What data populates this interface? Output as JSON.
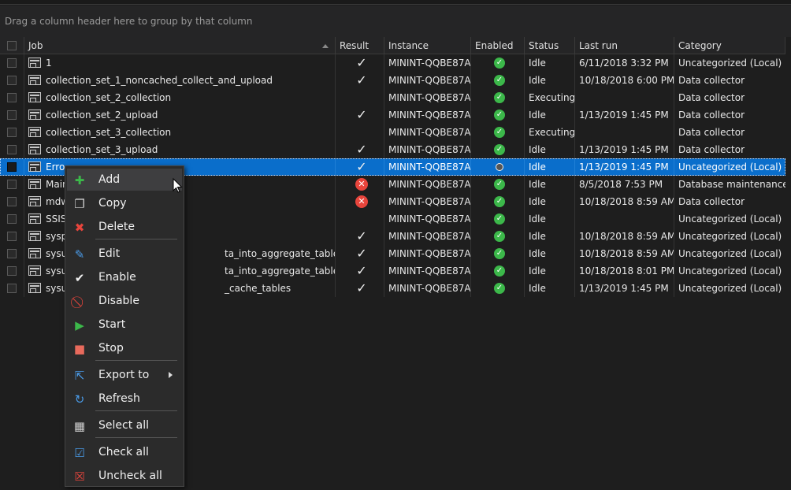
{
  "group_panel": {
    "hint": "Drag a column header here to group by that column"
  },
  "columns": [
    "Job",
    "Result",
    "Instance",
    "Enabled",
    "Status",
    "Last run",
    "Category"
  ],
  "rows": [
    {
      "job": "1",
      "result": "ok",
      "instance": "MININT-QQBE87A",
      "enabled": "on",
      "status": "Idle",
      "last_run": "6/11/2018 3:32 PM",
      "category": "Uncategorized (Local)"
    },
    {
      "job": "collection_set_1_noncached_collect_and_upload",
      "result": "ok",
      "instance": "MININT-QQBE87A",
      "enabled": "on",
      "status": "Idle",
      "last_run": "10/18/2018 6:00 PM",
      "category": "Data collector"
    },
    {
      "job": "collection_set_2_collection",
      "result": "",
      "instance": "MININT-QQBE87A",
      "enabled": "on",
      "status": "Executing",
      "last_run": "",
      "category": "Data collector"
    },
    {
      "job": "collection_set_2_upload",
      "result": "ok",
      "instance": "MININT-QQBE87A",
      "enabled": "on",
      "status": "Idle",
      "last_run": "1/13/2019 1:45 PM",
      "category": "Data collector"
    },
    {
      "job": "collection_set_3_collection",
      "result": "",
      "instance": "MININT-QQBE87A",
      "enabled": "on",
      "status": "Executing",
      "last_run": "",
      "category": "Data collector"
    },
    {
      "job": "collection_set_3_upload",
      "result": "ok",
      "instance": "MININT-QQBE87A",
      "enabled": "on",
      "status": "Idle",
      "last_run": "1/13/2019 1:45 PM",
      "category": "Data collector"
    },
    {
      "job": "Erro",
      "result": "ok",
      "instance": "MININT-QQBE87A",
      "enabled": "off",
      "status": "Idle",
      "last_run": "1/13/2019 1:45 PM",
      "category": "Uncategorized (Local)",
      "selected": true
    },
    {
      "job": "Main",
      "result": "fail",
      "instance": "MININT-QQBE87A",
      "enabled": "on",
      "status": "Idle",
      "last_run": "8/5/2018 7:53 PM",
      "category": "Database maintenance"
    },
    {
      "job": "mdw",
      "result": "fail",
      "instance": "MININT-QQBE87A",
      "enabled": "on",
      "status": "Idle",
      "last_run": "10/18/2018 8:59 AM",
      "category": "Data collector"
    },
    {
      "job": "SSIS",
      "result": "",
      "instance": "MININT-QQBE87A",
      "enabled": "on",
      "status": "Idle",
      "last_run": "",
      "category": "Uncategorized (Local)"
    },
    {
      "job": "sysp",
      "result": "ok",
      "instance": "MININT-QQBE87A",
      "enabled": "on",
      "status": "Idle",
      "last_run": "10/18/2018 8:59 AM",
      "category": "Uncategorized (Local)"
    },
    {
      "job": "sysu",
      "job_tail": "ta_into_aggregate_tables_daily",
      "result": "ok",
      "instance": "MININT-QQBE87A",
      "enabled": "on",
      "status": "Idle",
      "last_run": "10/18/2018 8:59 AM",
      "category": "Uncategorized (Local)"
    },
    {
      "job": "sysu",
      "job_tail": "ta_into_aggregate_tables_hourly",
      "result": "ok",
      "instance": "MININT-QQBE87A",
      "enabled": "on",
      "status": "Idle",
      "last_run": "10/18/2018 8:01 PM",
      "category": "Uncategorized (Local)"
    },
    {
      "job": "sysu",
      "job_tail": "_cache_tables",
      "result": "ok",
      "instance": "MININT-QQBE87A",
      "enabled": "on",
      "status": "Idle",
      "last_run": "1/13/2019 1:45 PM",
      "category": "Uncategorized (Local)"
    }
  ],
  "menu": {
    "items": [
      {
        "label": "Add",
        "icon": "plus-icon",
        "glyph": "✚",
        "color": "#3cb84a",
        "highlighted": true
      },
      {
        "label": "Copy",
        "icon": "copy-icon",
        "glyph": "❐",
        "color": "#d0d0d0"
      },
      {
        "label": "Delete",
        "icon": "delete-icon",
        "glyph": "✖",
        "color": "#e8453c"
      },
      {
        "label": "Edit",
        "icon": "pencil-icon",
        "glyph": "✎",
        "color": "#4a9be8",
        "sep_before": true
      },
      {
        "label": "Enable",
        "icon": "check-icon",
        "glyph": "✔",
        "color": "#f0f0f0"
      },
      {
        "label": "Disable",
        "icon": "disable-icon",
        "glyph": "⃠",
        "color": "#e8453c"
      },
      {
        "label": "Start",
        "icon": "play-icon",
        "glyph": "▶",
        "color": "#3cb84a"
      },
      {
        "label": "Stop",
        "icon": "stop-icon",
        "glyph": "■",
        "color": "#e86a5c"
      },
      {
        "label": "Export to",
        "icon": "export-icon",
        "glyph": "⇱",
        "color": "#4a9be8",
        "submenu": true,
        "sep_before": true
      },
      {
        "label": "Refresh",
        "icon": "refresh-icon",
        "glyph": "↻",
        "color": "#4a9be8"
      },
      {
        "label": "Select all",
        "icon": "select-all-icon",
        "glyph": "▦",
        "color": "#d0d0d0",
        "sep_before": true
      },
      {
        "label": "Check all",
        "icon": "check-all-icon",
        "glyph": "☑",
        "color": "#4a9be8",
        "sep_before": true
      },
      {
        "label": "Uncheck all",
        "icon": "uncheck-all-icon",
        "glyph": "☒",
        "color": "#e8453c"
      }
    ]
  }
}
